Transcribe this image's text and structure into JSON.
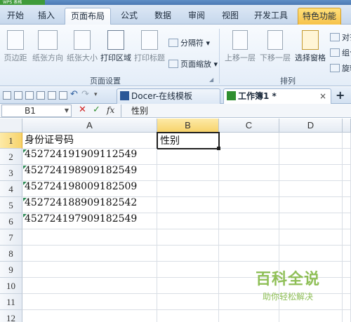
{
  "app": {
    "badge": "WPS 表格"
  },
  "menu": {
    "tabs": [
      "开始",
      "插入",
      "页面布局",
      "公式",
      "数据",
      "审阅",
      "视图",
      "开发工具",
      "特色功能"
    ],
    "active": "页面布局"
  },
  "ribbon": {
    "page_margin": "页边距",
    "orientation": "纸张方向",
    "paper_size": "纸张大小",
    "print_area": "打印区域",
    "print_titles": "打印标题",
    "page_break": "分隔符",
    "page_zoom": "页面缩放",
    "bring_forward": "上移一层",
    "send_backward": "下移一层",
    "selection_pane": "选择窗格",
    "align": "对齐",
    "group": "组合",
    "rotate": "旋转",
    "group_page_setup": "页面设置",
    "group_arrange": "排列"
  },
  "doc_tabs": [
    {
      "label": "Docer-在线模板",
      "close": "×"
    },
    {
      "label": "工作簿1 *",
      "close": "×"
    }
  ],
  "new_tab": "+",
  "formula": {
    "cell_ref": "B1",
    "cancel": "✕",
    "confirm": "✓",
    "fx": "fx",
    "content": "性别"
  },
  "columns": [
    "A",
    "B",
    "C",
    "D"
  ],
  "rows": [
    "1",
    "2",
    "3",
    "4",
    "5",
    "6",
    "7",
    "8",
    "9",
    "10",
    "11",
    "12"
  ],
  "cells": {
    "A1": "身份证号码",
    "B1": "性别",
    "A2": "452724191909112549",
    "A3": "452724198909182549",
    "A4": "452724198009182509",
    "A5": "452724188909182542",
    "A6": "452724197909182549"
  },
  "watermark": {
    "title": "百科全说",
    "subtitle": "助你轻松解决"
  }
}
